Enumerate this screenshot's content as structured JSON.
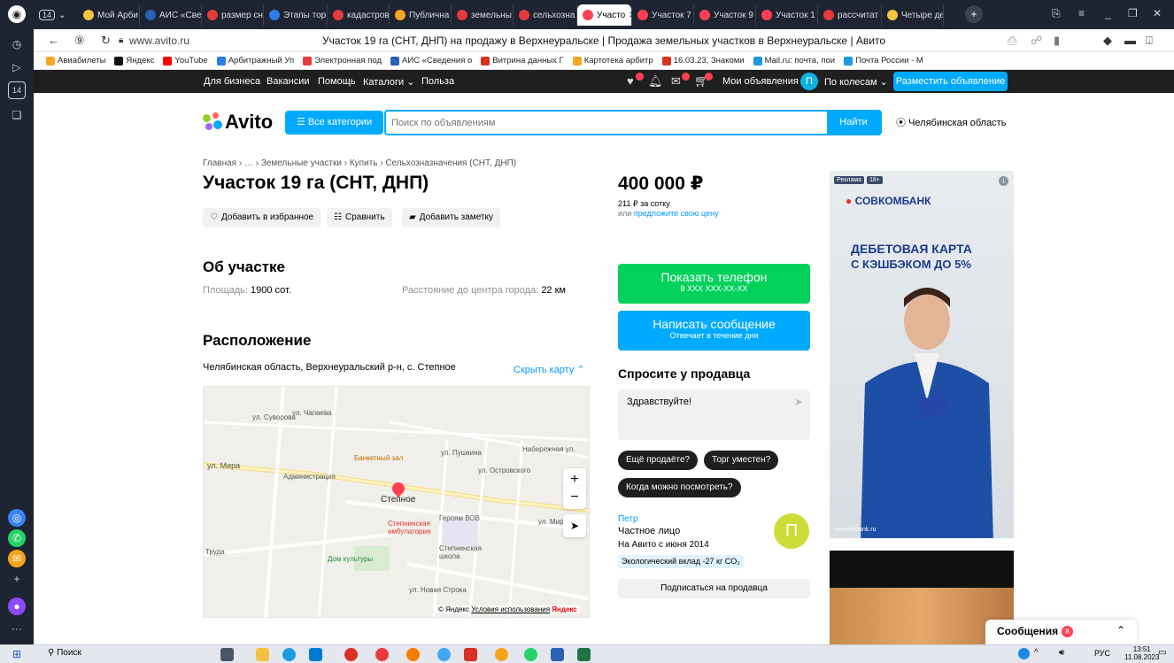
{
  "browser": {
    "tabs": [
      {
        "label": "Мой Арби",
        "color": "#f5c542"
      },
      {
        "label": "АИС «Све",
        "color": "#2b5fb8"
      },
      {
        "label": "размер сн",
        "color": "#e63b3b"
      },
      {
        "label": "Этапы тор",
        "color": "#2b7de9"
      },
      {
        "label": "кадастров",
        "color": "#e63b3b"
      },
      {
        "label": "Публична",
        "color": "#f5a623"
      },
      {
        "label": "земельны",
        "color": "#e63b3b"
      },
      {
        "label": "сельхозна",
        "color": "#e63b3b"
      },
      {
        "label": "Участо",
        "color": "#ff4053",
        "active": true
      },
      {
        "label": "Участок 7",
        "color": "#ff4053"
      },
      {
        "label": "Участок 9",
        "color": "#ff4053"
      },
      {
        "label": "Участок 1",
        "color": "#ff4053"
      },
      {
        "label": "рассчитат",
        "color": "#e63b3b"
      },
      {
        "label": "Четыре де",
        "color": "#f5c542"
      }
    ],
    "tab_count": "14",
    "url": "www.avito.ru",
    "page_title": "Участок 19 га (СНТ, ДНП) на продажу в Верхнеуральске | Продажа земельных участков в Верхнеуральске | Авито",
    "bookmarks": [
      "Авиабилеты",
      "Яндекс",
      "YouTube",
      "Арбитражный Уп",
      "Электронная под",
      "АИС «Сведения о",
      "Витрина данных Г",
      "Картотека арбитр",
      "16.03.23, Знакоми",
      "Mail.ru: почта, пои",
      "Почта России - М"
    ]
  },
  "topnav": {
    "links": [
      "Для бизнеса",
      "Вакансии",
      "Помощь",
      "Каталоги",
      "Польза"
    ],
    "my_ads": "Мои объявления",
    "avatar_letter": "П",
    "user": "По колесам",
    "post_button": "Разместить объявление"
  },
  "header": {
    "logo": "Avito",
    "categories_button": "Все категории",
    "search_placeholder": "Поиск по объявлениям",
    "search_button": "Найти",
    "region": "Челябинская область"
  },
  "listing": {
    "breadcrumb": "Главная › … › Земельные участки › Купить › Сельхозназначения (СНТ, ДНП)",
    "title": "Участок 19 га (СНТ, ДНП)",
    "actions": {
      "favorite": "Добавить в избранное",
      "compare": "Сравнить",
      "note": "Добавить заметку"
    },
    "about_title": "Об участке",
    "area_label": "Площадь:",
    "area_value": "1900 сот.",
    "distance_label": "Расстояние до центра города:",
    "distance_value": "22 км",
    "location_title": "Расположение",
    "address": "Челябинская область, Верхнеуральский р-н, с. Степное",
    "hide_map": "Скрыть карту"
  },
  "map": {
    "labels": [
      {
        "t": "ул. Суворова"
      },
      {
        "t": "ул. Чапаева"
      },
      {
        "t": "Банкетный зал"
      },
      {
        "t": "ул. Мира"
      },
      {
        "t": "Администрация"
      },
      {
        "t": "Степное"
      },
      {
        "t": "Степнинская амбулатория"
      },
      {
        "t": "Героям ВОВ"
      },
      {
        "t": "ул. Пушкина"
      },
      {
        "t": "ул. Островского"
      },
      {
        "t": "Набережная ул."
      },
      {
        "t": "Степнинская школа"
      },
      {
        "t": "Дом культуры"
      },
      {
        "t": "Труда"
      },
      {
        "t": "ул. Новая Строка"
      },
      {
        "t": "ул. Мира"
      }
    ],
    "copyright": "© Яндекс",
    "terms": "Условия использования",
    "brand": "Яндекс"
  },
  "side": {
    "price": "400 000 ₽",
    "price_per": "211 ₽ за сотку",
    "offer_prefix": "или",
    "offer_link": "предложите свою цену",
    "phone_btn": "Показать телефон",
    "phone_mask": "8 XXX XXX-XX-XX",
    "message_btn": "Написать сообщение",
    "message_sub": "Отвечает в течение дня",
    "ask_title": "Спросите у продавца",
    "ask_text": "Здравствуйте!",
    "chips": [
      "Ещё продаёте?",
      "Торг уместен?",
      "Когда можно посмотреть?"
    ],
    "seller_name": "Петр",
    "seller_type": "Частное лицо",
    "seller_since": "На Авито с июня 2014",
    "eco": "Экологический вклад -27 кг CO₂",
    "avatar_letter": "П",
    "subscribe": "Подписаться на продавца"
  },
  "ad": {
    "tag": "Реклама",
    "age": "18+",
    "bank": "СОВКОМБАНК",
    "headline1": "ДЕБЕТОВАЯ КАРТА",
    "headline2": "С КЭШБЭКОМ ДО 5%",
    "site": "sovcombank.ru"
  },
  "messages": {
    "label": "Сообщения",
    "count": "8"
  },
  "taskbar": {
    "search": "Поиск",
    "lang": "РУС",
    "time": "13:51",
    "date": "11.08.2023"
  }
}
